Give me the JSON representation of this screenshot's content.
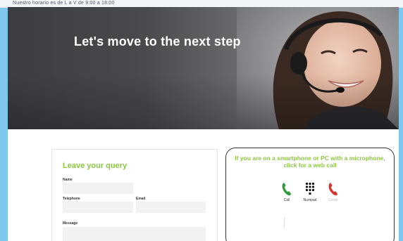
{
  "topbar": {
    "text": "Nuestro horario es de L a V de 9:00 a 18:00"
  },
  "hero": {
    "title": "Let's move to the next step"
  },
  "form": {
    "title": "Leave your query",
    "name_label": "Name",
    "telephone_label": "Telephone",
    "email_label": "Email",
    "message_label": "Message"
  },
  "webcall": {
    "instruction": "If you are on a smartphone or PC with a microphone, click for a web call",
    "call_label": "Call",
    "numpad_label": "Numpad",
    "cortar_label": "Cortar"
  },
  "colors": {
    "accent": "#8cc63f",
    "call_green": "#2e9a3a",
    "hang_red": "#d9342b",
    "frame_blue": "#7fc7ef"
  }
}
